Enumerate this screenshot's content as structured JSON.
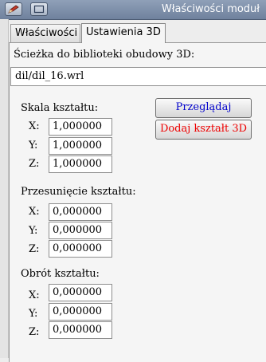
{
  "window": {
    "title": "Właściwości moduł",
    "icons": [
      "pencil-icon",
      "restore-icon"
    ],
    "colors": {
      "titlebar": "#7b8ca8",
      "browse_text": "#0000cc",
      "add_text": "#ee0000"
    }
  },
  "tabs": [
    {
      "label": "Właściwości"
    },
    {
      "label": "Ustawienia 3D"
    }
  ],
  "shape": {
    "path_label": "Ścieżka do biblioteki obudowy 3D:",
    "path_value": "dil/dil_16.wrl"
  },
  "buttons": {
    "browse": "Przeglądaj",
    "add_shape": "Dodaj kształt 3D"
  },
  "scale": {
    "heading": "Skala kształtu:",
    "x_label": "X:",
    "x": "1,000000",
    "y_label": "Y:",
    "y": "1,000000",
    "z_label": "Z:",
    "z": "1,000000"
  },
  "offset": {
    "heading": "Przesunięcie kształtu:",
    "x_label": "X:",
    "x": "0,000000",
    "y_label": "Y:",
    "y": "0,000000",
    "z_label": "Z:",
    "z": "0,000000"
  },
  "rotation": {
    "heading": "Obrót kształtu:",
    "x_label": "X:",
    "x": "0,000000",
    "y_label": "Y:",
    "y": "0,000000",
    "z_label": "Z:",
    "z": "0,000000"
  }
}
